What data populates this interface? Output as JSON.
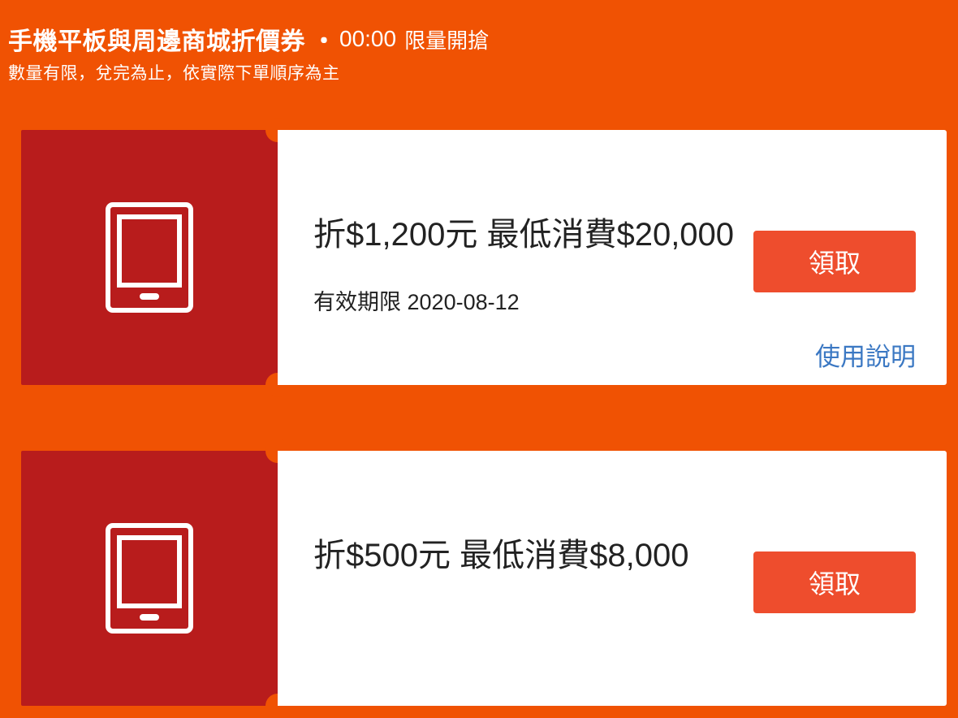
{
  "header": {
    "title": "手機平板與周邊商城折價券",
    "separator": "・",
    "time": "00:00",
    "suffix": "限量開搶",
    "subtitle": "數量有限，兌完為止，依實際下單順序為主"
  },
  "coupons": [
    {
      "icon": "tablet-icon",
      "amount_text": "折$1,200元 最低消費$20,000",
      "validity_label": "有效期限",
      "validity_date": "2020-08-12",
      "claim_label": "領取",
      "usage_label": "使用說明"
    },
    {
      "icon": "tablet-icon",
      "amount_text": "折$500元 最低消費$8,000",
      "claim_label": "領取"
    }
  ],
  "colors": {
    "background": "#f05203",
    "coupon_left": "#b81c1c",
    "button": "#ee4d2d",
    "link": "#3b78c3"
  }
}
